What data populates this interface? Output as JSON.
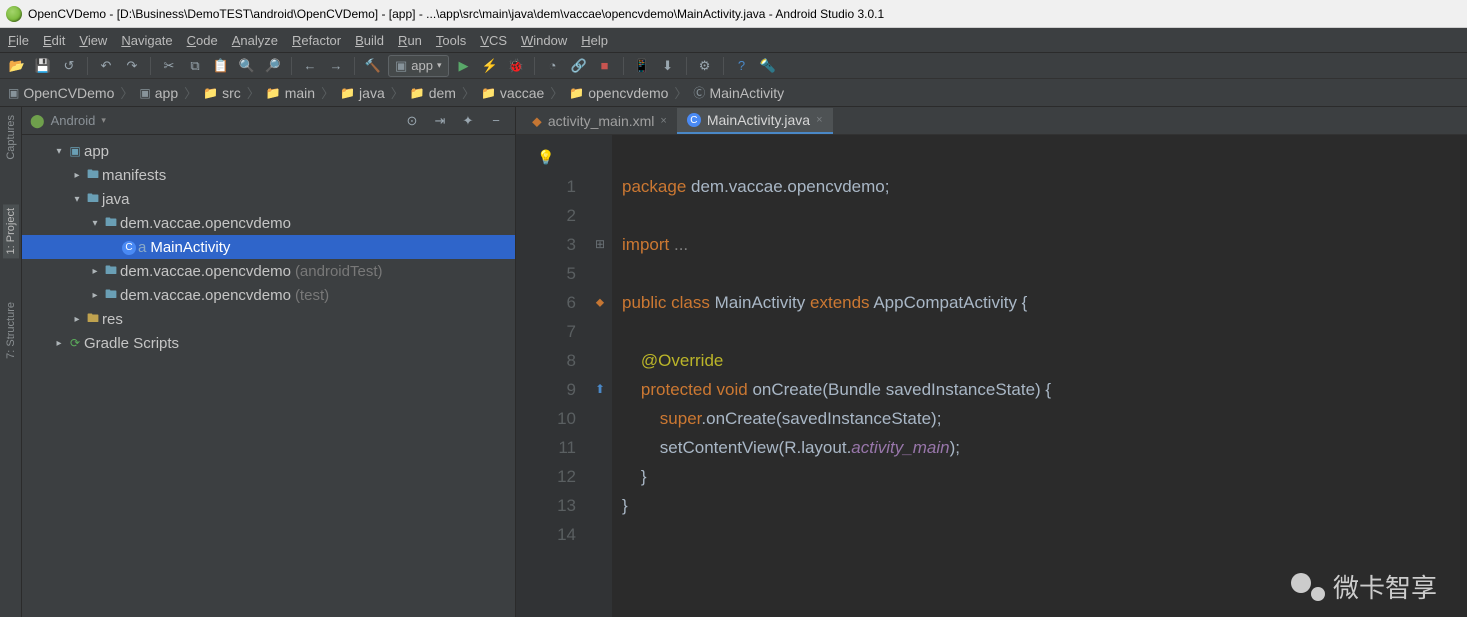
{
  "title": "OpenCVDemo - [D:\\Business\\DemoTEST\\android\\OpenCVDemo] - [app] - ...\\app\\src\\main\\java\\dem\\vaccae\\opencvdemo\\MainActivity.java - Android Studio 3.0.1",
  "menu": [
    "File",
    "Edit",
    "View",
    "Navigate",
    "Code",
    "Analyze",
    "Refactor",
    "Build",
    "Run",
    "Tools",
    "VCS",
    "Window",
    "Help"
  ],
  "run_config": "app",
  "breadcrumbs": [
    {
      "icon": "project",
      "label": "OpenCVDemo"
    },
    {
      "icon": "module",
      "label": "app"
    },
    {
      "icon": "folder",
      "label": "src"
    },
    {
      "icon": "folder",
      "label": "main"
    },
    {
      "icon": "folder",
      "label": "java"
    },
    {
      "icon": "folder",
      "label": "dem"
    },
    {
      "icon": "folder",
      "label": "vaccae"
    },
    {
      "icon": "folder",
      "label": "opencvdemo"
    },
    {
      "icon": "class",
      "label": "MainActivity"
    }
  ],
  "tool_strip": [
    {
      "label": "Captures",
      "active": false
    },
    {
      "label": "1: Project",
      "active": true
    },
    {
      "label": "7: Structure",
      "active": false
    }
  ],
  "project_view": "Android",
  "tree": [
    {
      "indent": 1,
      "arrow": "▾",
      "icon": "module",
      "label": "app",
      "selected": false
    },
    {
      "indent": 2,
      "arrow": "▸",
      "icon": "folder",
      "label": "manifests"
    },
    {
      "indent": 2,
      "arrow": "▾",
      "icon": "folder",
      "label": "java"
    },
    {
      "indent": 3,
      "arrow": "▾",
      "icon": "package",
      "label": "dem.vaccae.opencvdemo"
    },
    {
      "indent": 4,
      "arrow": "",
      "icon": "class",
      "label": "MainActivity",
      "selected": true,
      "prefix": "a"
    },
    {
      "indent": 3,
      "arrow": "▸",
      "icon": "package",
      "label": "dem.vaccae.opencvdemo",
      "suffix": "(androidTest)"
    },
    {
      "indent": 3,
      "arrow": "▸",
      "icon": "package",
      "label": "dem.vaccae.opencvdemo",
      "suffix": "(test)"
    },
    {
      "indent": 2,
      "arrow": "▸",
      "icon": "res",
      "label": "res"
    },
    {
      "indent": 1,
      "arrow": "▸",
      "icon": "gradle",
      "label": "Gradle Scripts"
    }
  ],
  "tabs": [
    {
      "label": "activity_main.xml",
      "icon": "xml",
      "active": false
    },
    {
      "label": "MainActivity.java",
      "icon": "class",
      "active": true
    }
  ],
  "code": {
    "lines": [
      1,
      2,
      3,
      5,
      6,
      7,
      8,
      9,
      10,
      11,
      12,
      13,
      14
    ],
    "content": [
      {
        "n": 1,
        "html": "<span class='kw'>package</span> dem.vaccae.opencvdemo;"
      },
      {
        "n": 2,
        "html": ""
      },
      {
        "n": 3,
        "html": "<span class='kw'>import</span> <span class='comment'>...</span>"
      },
      {
        "n": 5,
        "html": ""
      },
      {
        "n": 6,
        "html": "<span class='kw'>public class</span> MainActivity <span class='kw'>extends</span> AppCompatActivity {"
      },
      {
        "n": 7,
        "html": ""
      },
      {
        "n": 8,
        "html": "    <span class='annot'>@Override</span>"
      },
      {
        "n": 9,
        "html": "    <span class='kw'>protected</span> <span class='kw'>void</span> onCreate(Bundle savedInstanceState) {"
      },
      {
        "n": 10,
        "html": "        <span class='kw'>super</span>.onCreate(savedInstanceState);"
      },
      {
        "n": 11,
        "html": "        setContentView(R.layout.<span class='field'>activity_main</span>);"
      },
      {
        "n": 12,
        "html": "    }"
      },
      {
        "n": 13,
        "html": "}"
      },
      {
        "n": 14,
        "html": ""
      }
    ]
  },
  "watermark": "微卡智享"
}
